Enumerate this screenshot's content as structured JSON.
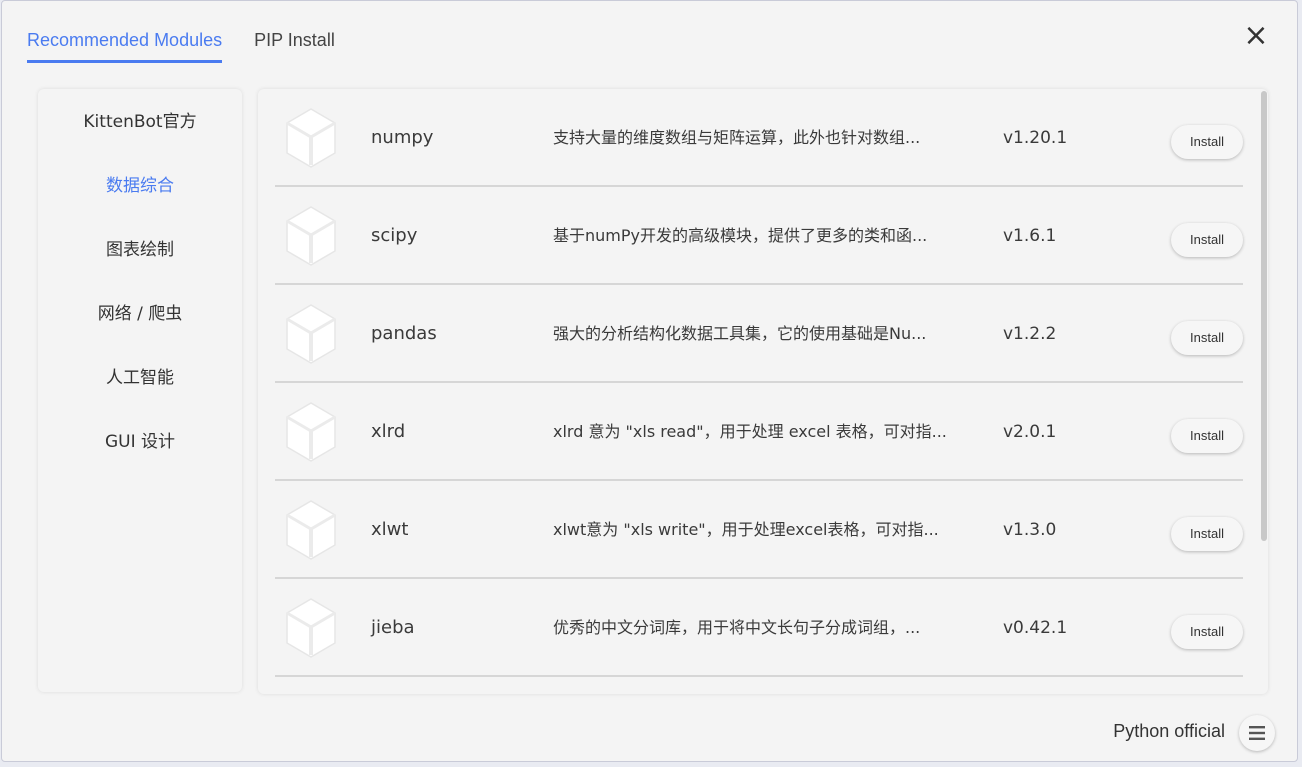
{
  "tabs": [
    {
      "label": "Recommended Modules"
    },
    {
      "label": "PIP Install"
    }
  ],
  "close_icon": "×",
  "sidebar": {
    "items": [
      {
        "label": "KittenBot官方"
      },
      {
        "label": "数据综合"
      },
      {
        "label": "图表绘制"
      },
      {
        "label": "网络 / 爬虫"
      },
      {
        "label": "人工智能"
      },
      {
        "label": "GUI 设计"
      }
    ]
  },
  "modules": [
    {
      "name": "numpy",
      "desc": "支持大量的维度数组与矩阵运算，此外也针对数组...",
      "version": "v1.20.1",
      "action": "Install"
    },
    {
      "name": "scipy",
      "desc": "基于numPy开发的高级模块，提供了更多的类和函...",
      "version": "v1.6.1",
      "action": "Install"
    },
    {
      "name": "pandas",
      "desc": "强大的分析结构化数据工具集，它的使用基础是Nu...",
      "version": "v1.2.2",
      "action": "Install"
    },
    {
      "name": "xlrd",
      "desc": "xlrd 意为 \"xls read\"，用于处理 excel 表格，可对指...",
      "version": "v2.0.1",
      "action": "Install"
    },
    {
      "name": "xlwt",
      "desc": "xlwt意为 \"xls write\"，用于处理excel表格，可对指...",
      "version": "v1.3.0",
      "action": "Install"
    },
    {
      "name": "jieba",
      "desc": "优秀的中文分词库，用于将中文长句子分成词组，...",
      "version": "v0.42.1",
      "action": "Install"
    }
  ],
  "footer": {
    "source_label": "Python official"
  },
  "colors": {
    "accent": "#4a7bf0",
    "panel": "#f4f4f4",
    "divider": "#d6d6d6"
  },
  "icons": {
    "module": "package-cube-icon",
    "menu": "hamburger-menu-icon",
    "close": "close-icon"
  }
}
